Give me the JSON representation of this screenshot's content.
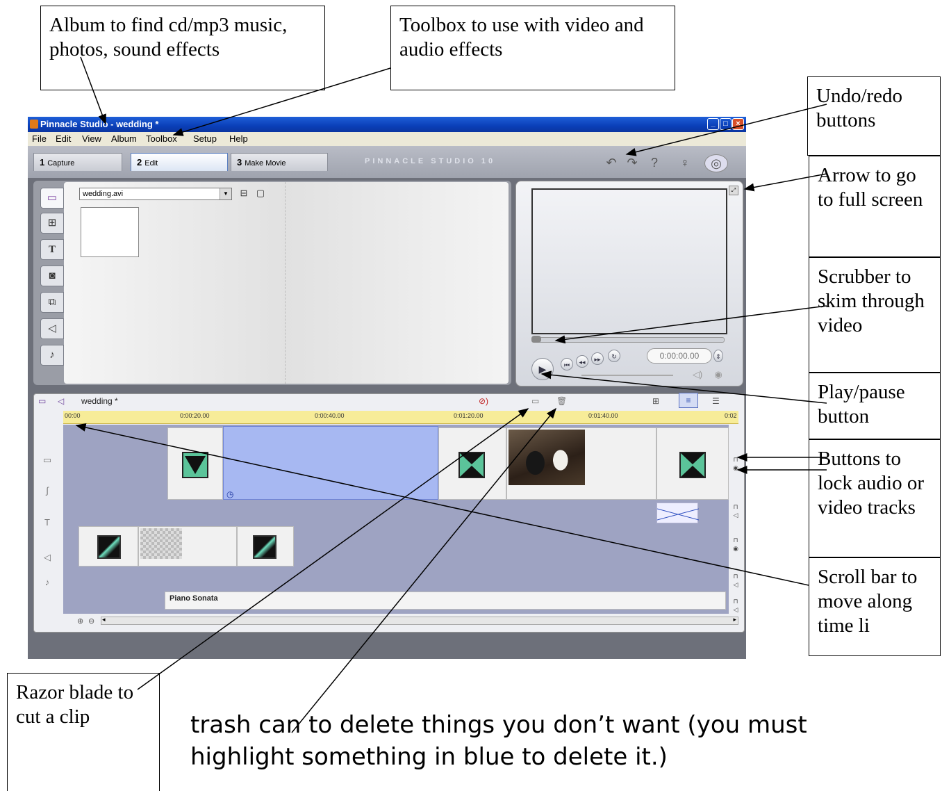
{
  "callouts": {
    "album": "Album to find cd/mp3 music, photos, sound effects",
    "toolbox": "Toolbox to use with video and audio effects",
    "undo_redo": "Undo/redo buttons",
    "fullscreen": "Arrow to go to full screen",
    "scrubber": "Scrubber to skim through video",
    "play_pause": "Play/pause button",
    "lock_buttons": "Buttons to lock audio or video tracks",
    "scroll_bar": "Scroll bar to move along time li",
    "razor": "Razor blade to cut a clip",
    "trash": "trash can to delete things you don’t want (you must highlight something in blue to delete it.)"
  },
  "app": {
    "title": "Pinnacle Studio - wedding *",
    "menu": [
      "File",
      "Edit",
      "View",
      "Album",
      "Toolbox",
      "Setup",
      "Help"
    ],
    "tabs": [
      {
        "num": "1",
        "label": "Capture"
      },
      {
        "num": "2",
        "label": "Edit"
      },
      {
        "num": "3",
        "label": "Make Movie"
      }
    ],
    "brand": "PINNACLE STUDIO 10",
    "album_file": "wedding.avi",
    "counter": "0:00:00.00",
    "timeline_title": "wedding *",
    "ruler_ticks": [
      "00:00",
      "0:00:20.00",
      "0:00:40.00",
      "0:01:20.00",
      "0:01:40.00",
      "0:02"
    ],
    "music_clip": "Piano Sonata"
  },
  "colors": {
    "titlebar": "#0a3fb8",
    "ruler": "#f7ec98",
    "tracks": "#9ea3c2",
    "selected_clip": "#a7b8f2",
    "transition": "#5bc49a"
  }
}
